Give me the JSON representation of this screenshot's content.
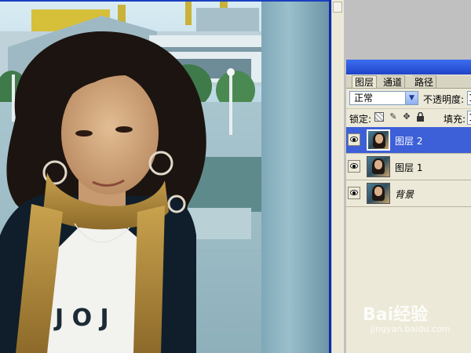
{
  "layers_panel": {
    "tabs": [
      {
        "label": "图层",
        "active": true
      },
      {
        "label": "通道",
        "active": false
      },
      {
        "label": "路径",
        "active": false
      }
    ],
    "blend_mode": "正常",
    "opacity_label": "不透明度:",
    "opacity_value": "1",
    "lock_label": "锁定:",
    "fill_label": "填充:",
    "fill_value": "1",
    "layers": [
      {
        "name": "图层 2",
        "selected": true,
        "visible": true
      },
      {
        "name": "图层 1",
        "selected": false,
        "visible": true
      },
      {
        "name": "背景",
        "selected": false,
        "visible": true
      }
    ]
  },
  "watermark": {
    "brand": "Bai经验",
    "url": "jingyan.baidu.com"
  },
  "colors": {
    "selected_layer": "#3d5fd8",
    "panel_bg": "#ece9d8",
    "workspace": "#c0c0c0",
    "title_bar": "#2a56d8"
  },
  "icons": [
    "eye-icon",
    "lock-transparency-icon",
    "brush-icon",
    "move-icon",
    "lock-icon",
    "dropdown-arrow-icon"
  ]
}
